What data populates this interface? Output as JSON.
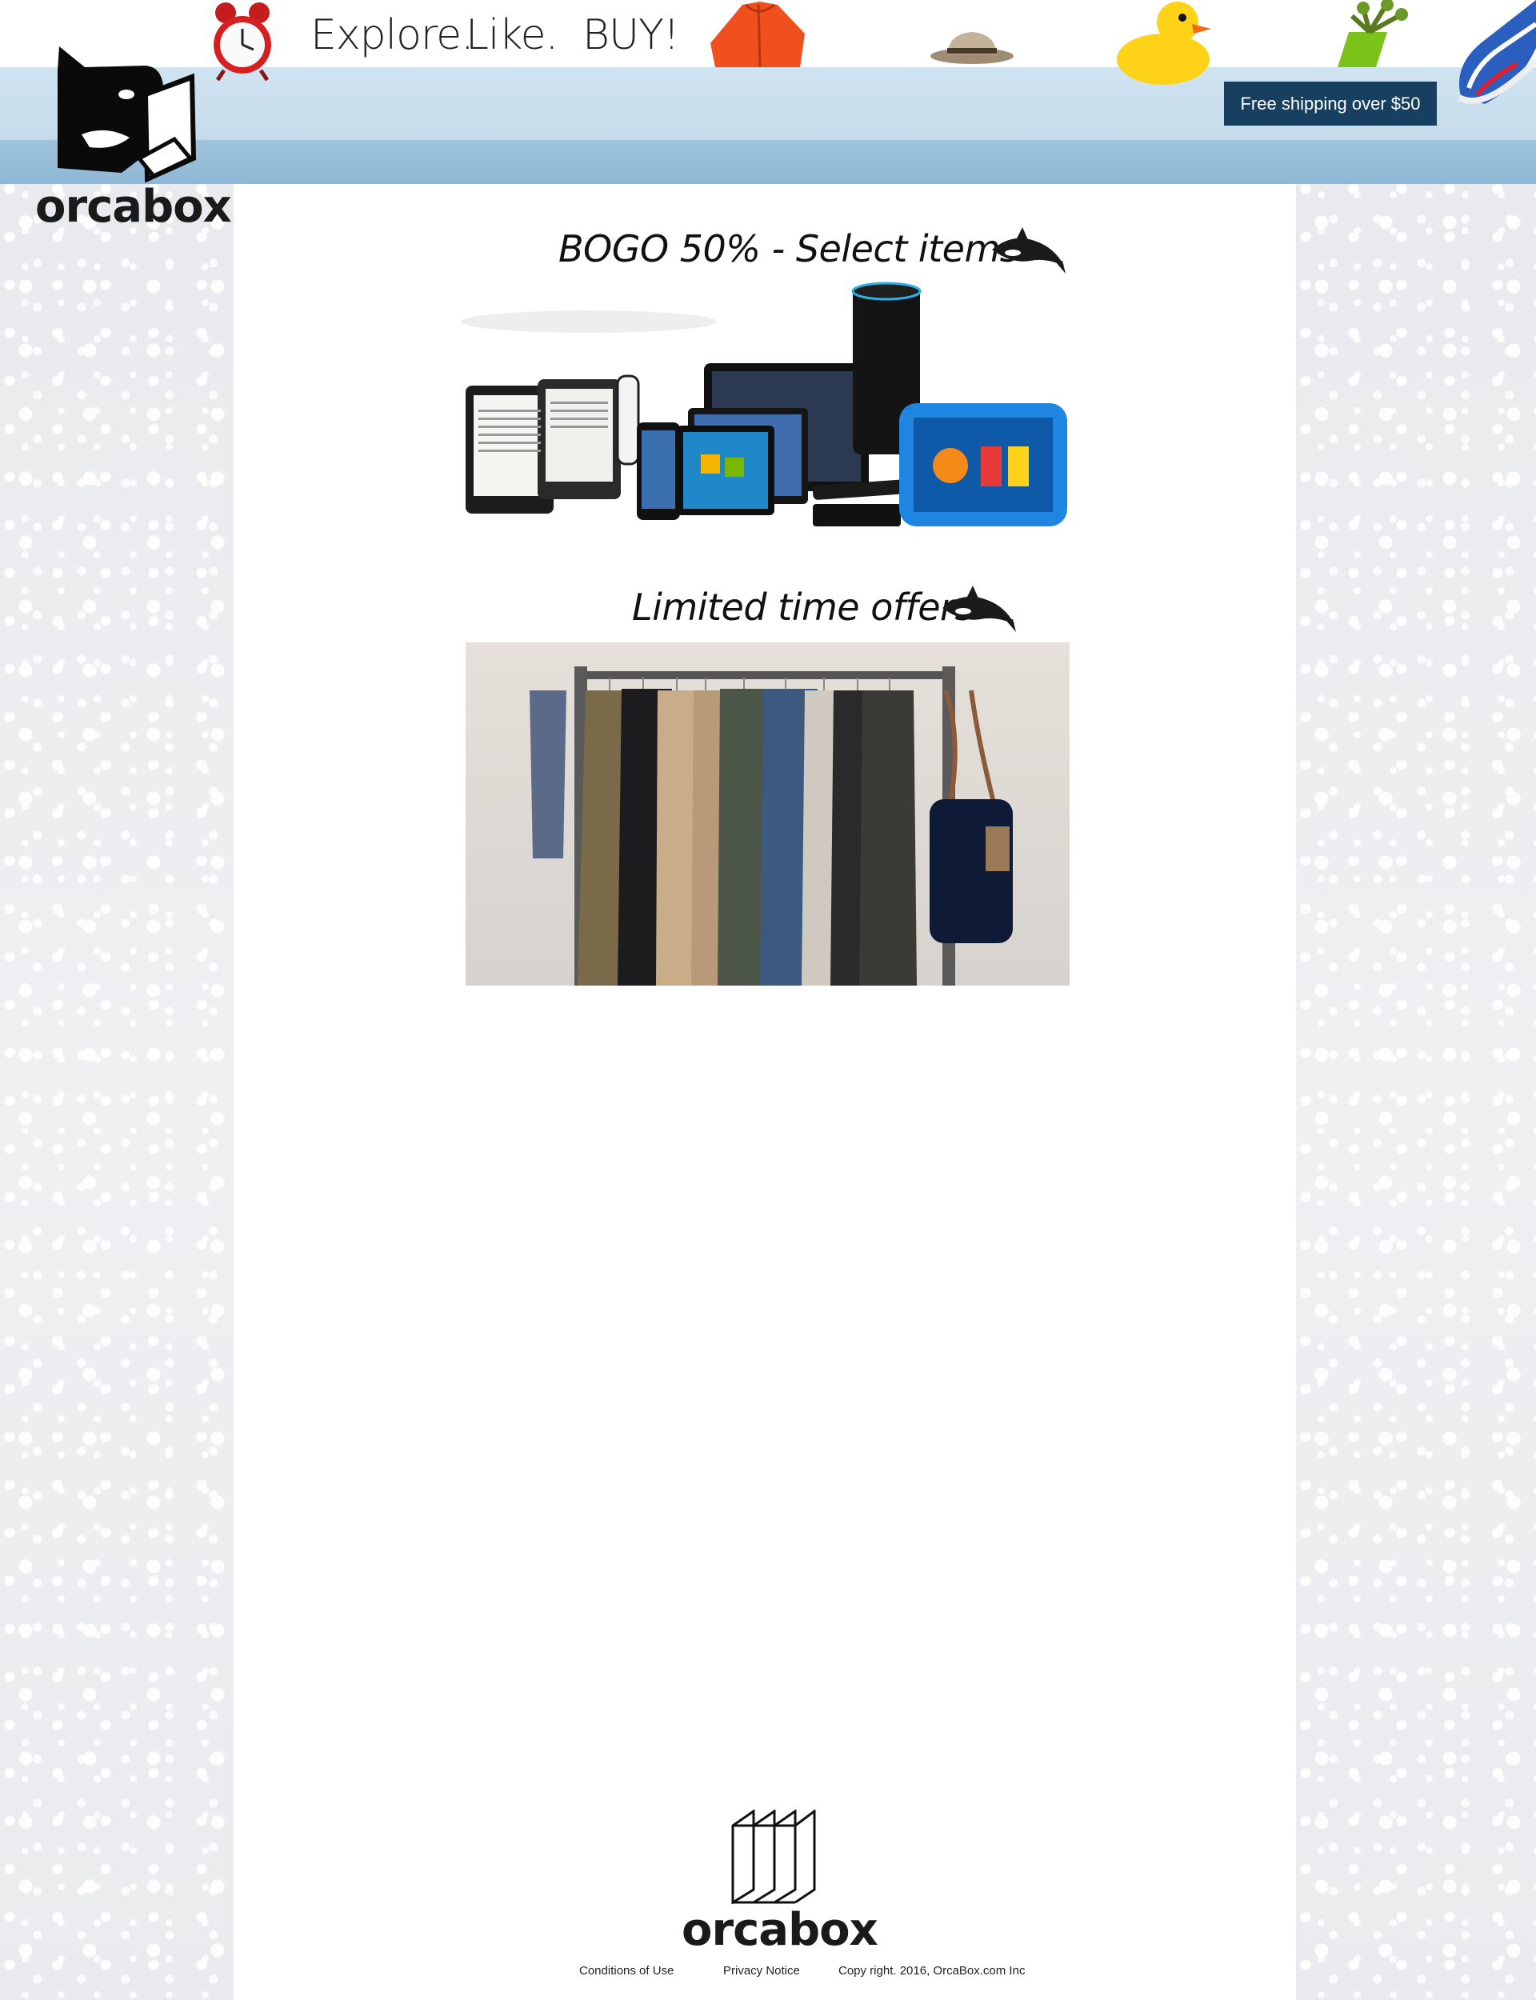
{
  "header": {
    "tagline": [
      "Explore.",
      "Like.",
      "BUY!"
    ],
    "shipping_badge": "Free shipping over $50",
    "brand_color": "#173f5f"
  },
  "logo": {
    "text": "orcabox",
    "icon": "orca-box-icon"
  },
  "sections": [
    {
      "title": "BOGO 50% - Select items",
      "icon": "orca-icon",
      "image": "kindle-devices-image"
    },
    {
      "title": "Limited time offers",
      "icon": "orca-icon",
      "image": "clothing-rack-image"
    }
  ],
  "decorations": [
    "alarm-clock-icon",
    "orange-jacket-icon",
    "fedora-hat-icon",
    "rubber-duck-icon",
    "potted-plant-icon",
    "sneaker-icon"
  ],
  "footer": {
    "logo_text": "orcabox",
    "links": [
      "Conditions of Use",
      "Privacy Notice"
    ],
    "copyright": "Copy right. 2016, OrcaBox.com Inc"
  }
}
